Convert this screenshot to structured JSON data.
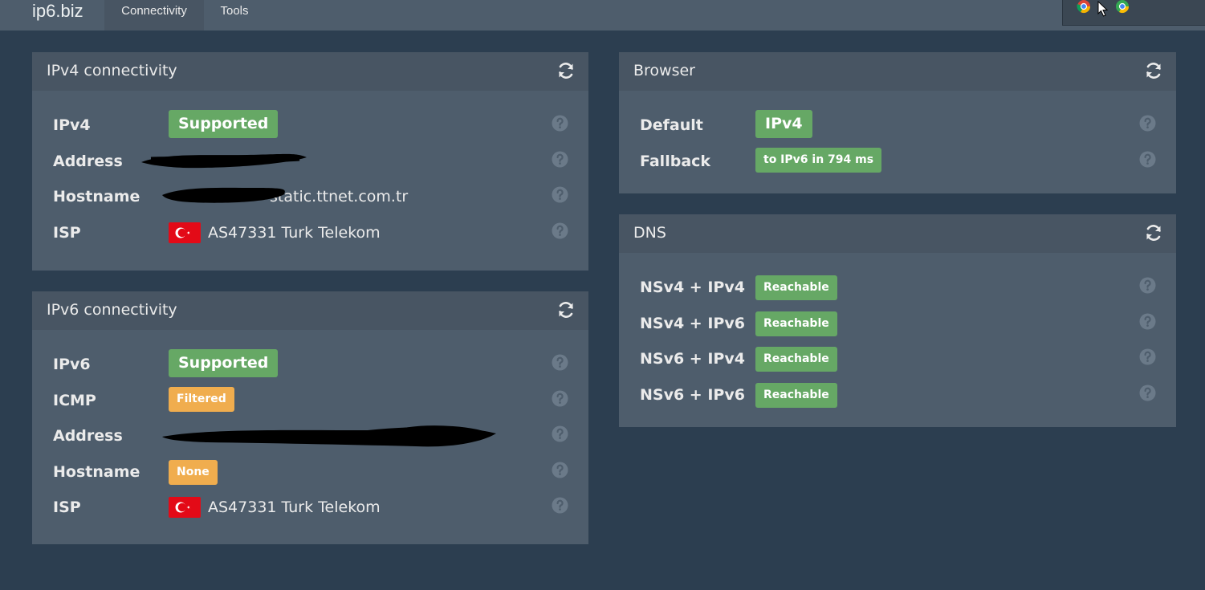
{
  "nav": {
    "brand": "ip6.biz",
    "tabs": [
      {
        "label": "Connectivity",
        "active": true
      },
      {
        "label": "Tools",
        "active": false
      }
    ]
  },
  "colors": {
    "background": "#2c3e50",
    "panel": "#4e5d6c",
    "panel_heading": "#485563",
    "success": "#66a865",
    "warning": "#f0ad4e"
  },
  "ipv4": {
    "title": "IPv4 connectivity",
    "rows": {
      "ipv4": {
        "label": "IPv4",
        "badge": "Supported"
      },
      "address": {
        "label": "Address",
        "value": ""
      },
      "hostname": {
        "label": "Hostname",
        "value": "static.ttnet.com.tr"
      },
      "isp": {
        "label": "ISP",
        "value": "AS47331 Turk Telekom",
        "flag": "turkey-flag"
      }
    }
  },
  "ipv6": {
    "title": "IPv6 connectivity",
    "rows": {
      "ipv6": {
        "label": "IPv6",
        "badge": "Supported"
      },
      "icmp": {
        "label": "ICMP",
        "badge": "Filtered"
      },
      "address": {
        "label": "Address",
        "value": ""
      },
      "hostname": {
        "label": "Hostname",
        "badge": "None"
      },
      "isp": {
        "label": "ISP",
        "value": "AS47331 Turk Telekom",
        "flag": "turkey-flag"
      }
    }
  },
  "browser": {
    "title": "Browser",
    "rows": {
      "default": {
        "label": "Default",
        "badge": "IPv4"
      },
      "fallback": {
        "label": "Fallback",
        "badge": "to IPv6 in 794 ms"
      }
    }
  },
  "dns": {
    "title": "DNS",
    "rows": [
      {
        "label": "NSv4 + IPv4",
        "badge": "Reachable"
      },
      {
        "label": "NSv4 + IPv6",
        "badge": "Reachable"
      },
      {
        "label": "NSv6 + IPv4",
        "badge": "Reachable"
      },
      {
        "label": "NSv6 + IPv6",
        "badge": "Reachable"
      }
    ]
  },
  "icons": {
    "refresh": "refresh-icon",
    "help": "question-circle-icon",
    "flag": "turkey-flag-icon"
  }
}
